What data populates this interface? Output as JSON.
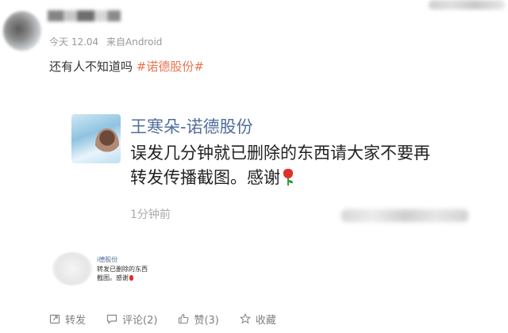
{
  "post": {
    "time": "今天 12.04",
    "source": "来自Android",
    "text": "还有人不知道吗",
    "topic": "#诺德股份#"
  },
  "screenshot": {
    "name": "王寒朵-诺德股份",
    "body_line1": "误发几分钟就已删除的东西请大家不要再",
    "body_line2": "转发传播截图。感谢",
    "time": "1分钟前"
  },
  "thumbnail": {
    "name": "i德股份",
    "line1": "转发已删除的东西",
    "line2": "截图。感谢"
  },
  "actions": {
    "repost": "转发",
    "comment": "评论(2)",
    "like": "赞(3)",
    "favorite": "收藏"
  },
  "colors": {
    "topic": "#eb7350",
    "name_blue": "#516e9b",
    "meta_gray": "#999999"
  }
}
